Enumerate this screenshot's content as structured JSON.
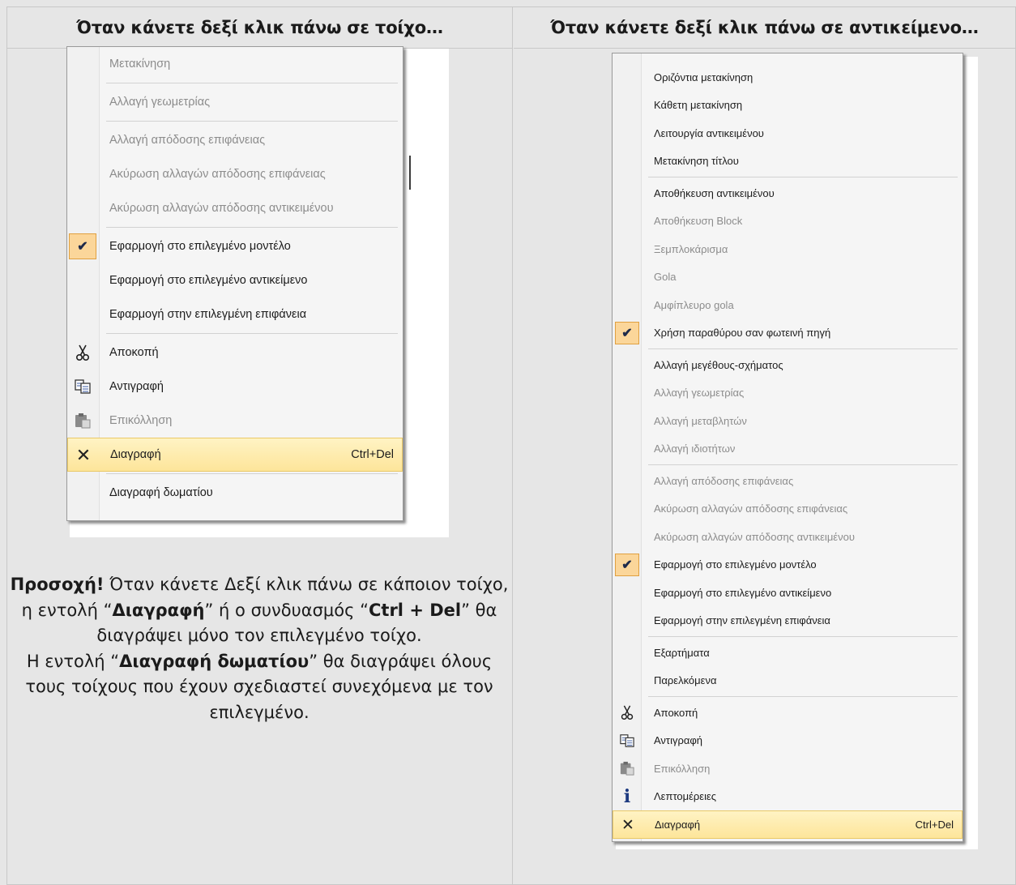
{
  "headers": {
    "left": "Όταν κάνετε δεξί κλικ πάνω σε τοίχο…",
    "right": "Όταν κάνετε δεξί κλικ πάνω σε αντικείμενο…"
  },
  "wall_menu": {
    "items": [
      {
        "label": "Μετακίνηση",
        "disabled": true
      },
      {
        "label": "Αλλαγή γεωμετρίας",
        "disabled": true
      },
      {
        "label": "Αλλαγή απόδοσης επιφάνειας",
        "disabled": true
      },
      {
        "label": "Ακύρωση αλλαγών απόδοσης επιφάνειας",
        "disabled": true
      },
      {
        "label": "Ακύρωση αλλαγών απόδοσης αντικειμένου",
        "disabled": true
      },
      {
        "label": "Εφαρμογή στο επιλεγμένο μοντέλο",
        "checked": true
      },
      {
        "label": "Εφαρμογή στο επιλεγμένο αντικείμενο"
      },
      {
        "label": "Εφαρμογή στην επιλεγμένη επιφάνεια"
      },
      {
        "label": "Αποκοπή",
        "icon": "scissors-icon"
      },
      {
        "label": "Αντιγραφή",
        "icon": "copy-icon"
      },
      {
        "label": "Επικόλληση",
        "icon": "paste-icon",
        "disabled": true
      },
      {
        "label": "Διαγραφή",
        "icon": "delete-x-icon",
        "shortcut": "Ctrl+Del",
        "highlighted": true
      },
      {
        "label": "Διαγραφή δωματίου"
      }
    ]
  },
  "object_menu": {
    "items": [
      {
        "label": "Οριζόντια μετακίνηση"
      },
      {
        "label": "Κάθετη μετακίνηση"
      },
      {
        "label": "Λειτουργία αντικειμένου"
      },
      {
        "label": "Μετακίνηση τίτλου"
      },
      {
        "label": "Αποθήκευση αντικειμένου"
      },
      {
        "label": "Αποθήκευση Block",
        "disabled": true
      },
      {
        "label": "Ξεμπλοκάρισμα",
        "disabled": true
      },
      {
        "label": "Gola",
        "disabled": true
      },
      {
        "label": "Αμφίπλευρο gola",
        "disabled": true
      },
      {
        "label": "Χρήση παραθύρου σαν φωτεινή πηγή",
        "checked": true
      },
      {
        "label": "Αλλαγή μεγέθους-σχήματος"
      },
      {
        "label": "Αλλαγή γεωμετρίας",
        "disabled": true
      },
      {
        "label": "Αλλαγή μεταβλητών",
        "disabled": true
      },
      {
        "label": "Αλλαγή ιδιοτήτων",
        "disabled": true
      },
      {
        "label": "Αλλαγή απόδοσης επιφάνειας",
        "disabled": true
      },
      {
        "label": "Ακύρωση αλλαγών απόδοσης επιφάνειας",
        "disabled": true
      },
      {
        "label": "Ακύρωση αλλαγών απόδοσης αντικειμένου",
        "disabled": true
      },
      {
        "label": "Εφαρμογή στο επιλεγμένο μοντέλο",
        "checked": true
      },
      {
        "label": "Εφαρμογή στο επιλεγμένο αντικείμενο"
      },
      {
        "label": "Εφαρμογή στην επιλεγμένη επιφάνεια"
      },
      {
        "label": "Εξαρτήματα"
      },
      {
        "label": "Παρελκόμενα"
      },
      {
        "label": "Αποκοπή",
        "icon": "scissors-icon"
      },
      {
        "label": "Αντιγραφή",
        "icon": "copy-icon"
      },
      {
        "label": "Επικόλληση",
        "icon": "paste-icon",
        "disabled": true
      },
      {
        "label": "Λεπτομέρειες",
        "icon": "info-icon"
      },
      {
        "label": "Διαγραφή",
        "icon": "delete-x-icon",
        "shortcut": "Ctrl+Del",
        "highlighted": true
      }
    ]
  },
  "note": {
    "p1_bold": "Προσοχή!",
    "p1_a": " Όταν κάνετε Δεξί κλικ πάνω σε κάποιον τοίχο, η εντολή “",
    "p1_cmd": "Διαγραφή",
    "p1_b": "” ή ο συνδυασμός “",
    "p1_keys": "Ctrl + Del",
    "p1_c": "” θα διαγράψει μόνο τον επιλεγμένο τοίχο.",
    "p2_a": "Η εντολή “",
    "p2_cmd": "Διαγραφή δωματίου",
    "p2_b": "” θα διαγράψει όλους τους τοίχους που έχουν σχεδιαστεί συνεχόμενα με τον επιλεγμένο."
  },
  "colors": {
    "highlight": "#fde59a",
    "check_bg": "#fbd69a",
    "disabled_text": "#8c8c8c",
    "panel_bg": "#e6e6e6"
  }
}
